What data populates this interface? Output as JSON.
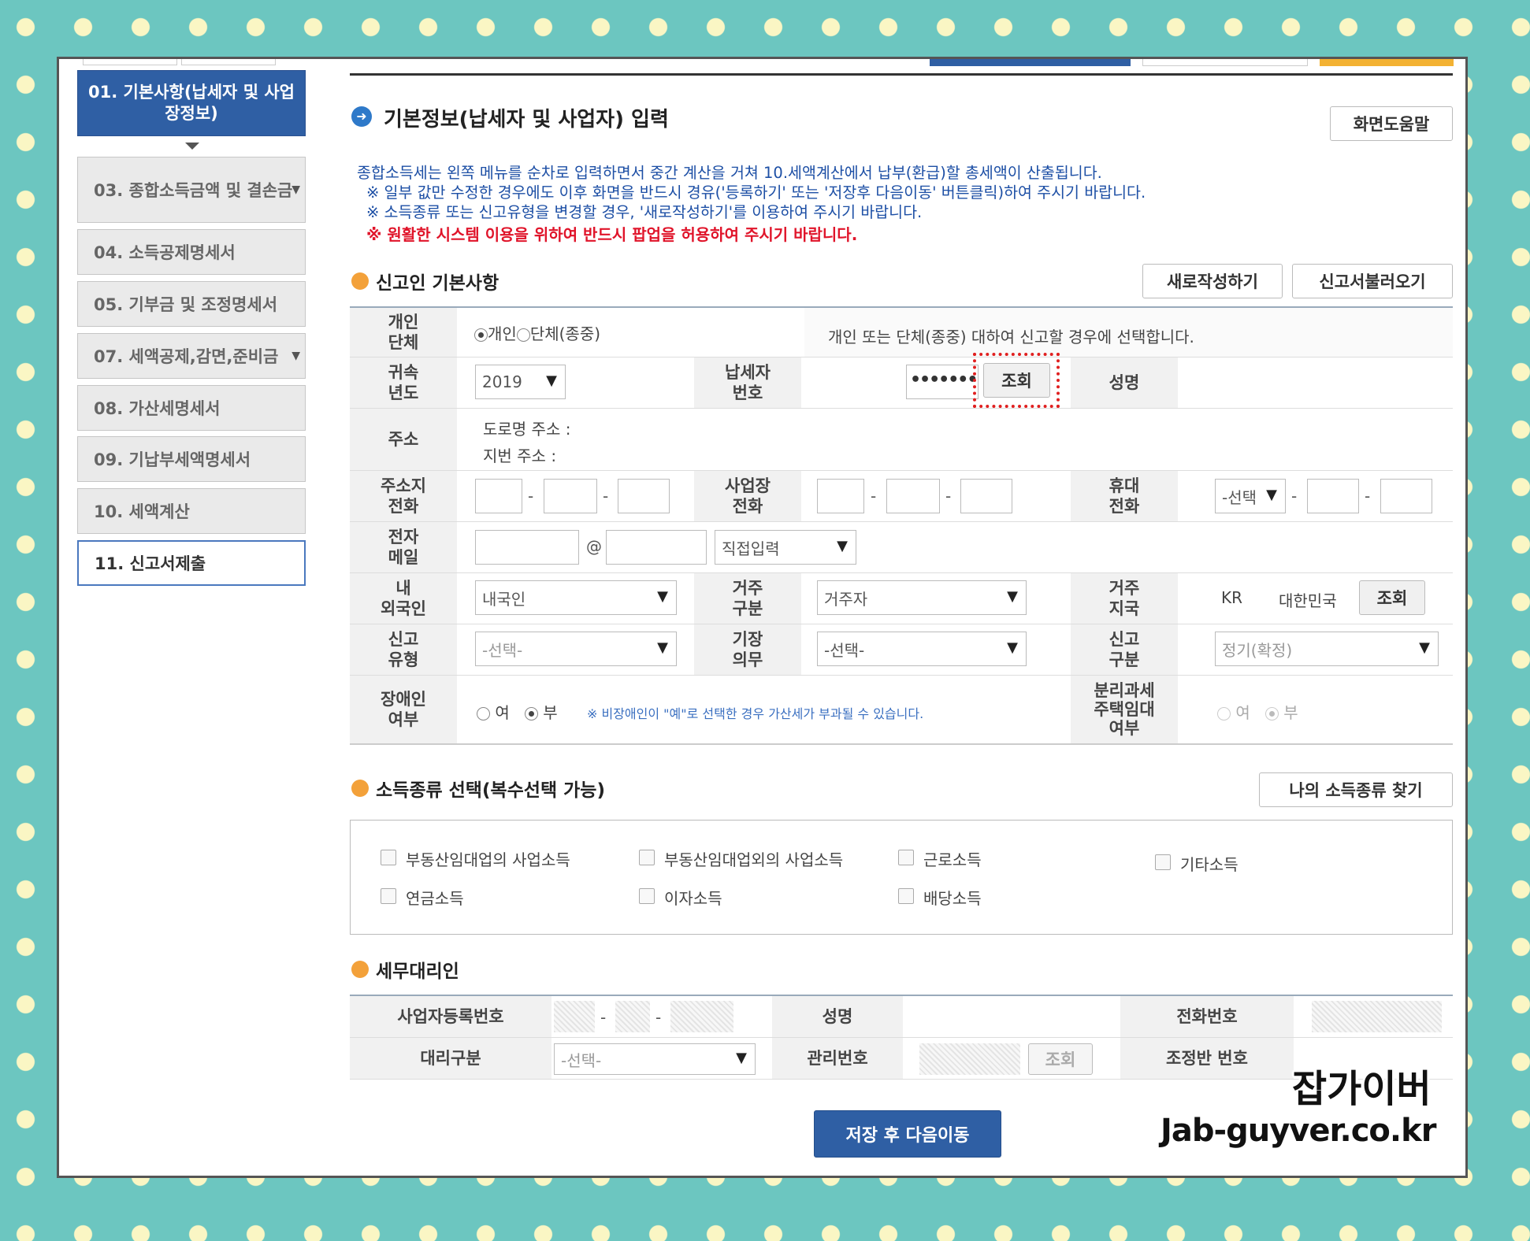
{
  "sidebar": {
    "items": [
      {
        "label": "01. 기본사항(납세자 및 사업장정보)"
      },
      {
        "label": "03. 종합소득금액 및 결손금"
      },
      {
        "label": "04. 소득공제명세서"
      },
      {
        "label": "05. 기부금 및 조정명세서"
      },
      {
        "label": "07. 세액공제,감면,준비금"
      },
      {
        "label": "08. 가산세명세서"
      },
      {
        "label": "09. 기납부세액명세서"
      },
      {
        "label": "10. 세액계산"
      },
      {
        "label": "11. 신고서제출"
      }
    ]
  },
  "header": {
    "title": "기본정보(납세자 및 사업자) 입력",
    "help_button": "화면도움말"
  },
  "notice": {
    "line1": "종합소득세는 왼쪽 메뉴를 순차로 입력하면서 중간 계산을 거쳐 10.세액계산에서 납부(환급)할 총세액이 산출됩니다.",
    "line2": "※ 일부 값만 수정한 경우에도 이후 화면을 반드시 경유('등록하기' 또는 '저장후 다음이동' 버튼클릭)하여 주시기 바랍니다.",
    "line3": "※ 소득종류 또는 신고유형을 변경할 경우, '새로작성하기'를 이용하여 주시기 바랍니다.",
    "warning": "※ 원활한 시스템 이용을 위하여 반드시 팝업을 허용하여 주시기 바랍니다."
  },
  "basic": {
    "title": "신고인 기본사항",
    "new_button": "새로작성하기",
    "load_button": "신고서불러오기",
    "type_label": "개인\n단체",
    "type_individual": "개인",
    "type_group": "단체(종중)",
    "type_hint": "개인 또는 단체(종중) 대하여 신고할 경우에 선택합니다.",
    "year_label": "귀속\n년도",
    "year_value": "2019",
    "taxpayer_label": "납세자\n번호",
    "taxpayer_masked": "•••••••",
    "lookup_button": "조회",
    "name_label": "성명",
    "address_label": "주소",
    "road_address": "도로명 주소 :",
    "lot_address": "지번 주소 :",
    "home_phone_label": "주소지\n전화",
    "biz_phone_label": "사업장\n전화",
    "mobile_label": "휴대\n전화",
    "mobile_select": "-선택",
    "email_label": "전자\n메일",
    "email_at": "@",
    "email_select": "직접입력",
    "nationality_label": "내\n외국인",
    "nationality_value": "내국인",
    "residency_label": "거주\n구분",
    "residency_value": "거주자",
    "country_label": "거주\n지국",
    "country_code": "KR",
    "country_name": "대한민국",
    "country_button": "조회",
    "report_type_label": "신고\n유형",
    "report_type_value": "-선택-",
    "bookkeeping_label": "기장\n의무",
    "bookkeeping_value": "-선택-",
    "report_class_label": "신고\n구분",
    "report_class_value": "정기(확정)",
    "disabled_label": "장애인\n여부",
    "yes": "여",
    "no": "부",
    "disabled_note": "※ 비장애인이 \"예\"로 선택한 경우 가산세가 부과될 수 있습니다.",
    "separate_tax_label": "분리과세\n주택임대\n여부"
  },
  "income": {
    "title": "소득종류 선택(복수선택 가능)",
    "find_button": "나의 소득종류 찾기",
    "options": [
      "부동산임대업의 사업소득",
      "부동산임대업외의 사업소득",
      "근로소득",
      "기타소득",
      "연금소득",
      "이자소득",
      "배당소득"
    ]
  },
  "agent": {
    "title": "세무대리인",
    "reg_no_label": "사업자등록번호",
    "name_label": "성명",
    "phone_label": "전화번호",
    "type_label": "대리구분",
    "type_value": "-선택-",
    "manage_no_label": "관리번호",
    "lookup_button": "조회",
    "team_no_label": "조정반 번호"
  },
  "footer": {
    "save_button": "저장 후 다음이동"
  },
  "watermark": {
    "line1": "잡가이버",
    "line2": "Jab-guyver.co.kr"
  },
  "colors": {
    "active_blue": "#2f5fa4",
    "notice_blue": "#1d4fa5",
    "warning_red": "#e0142a",
    "section_orange": "#f3a13a",
    "highlight_red": "#e02020"
  }
}
